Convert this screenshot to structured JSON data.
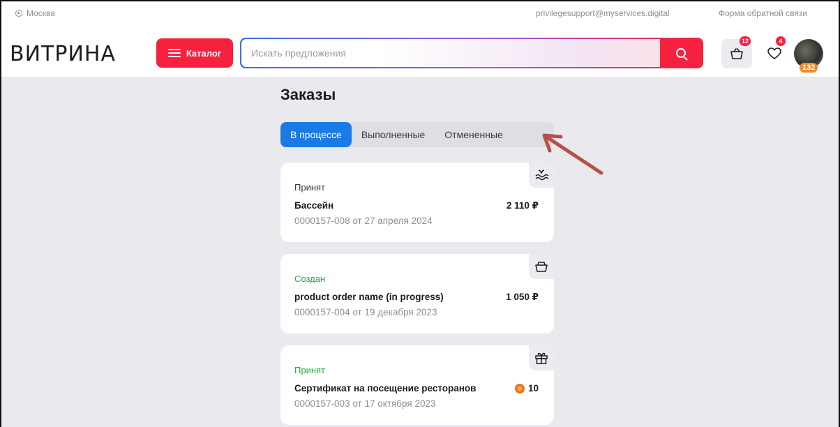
{
  "topbar": {
    "city": "Москва",
    "email": "privilegesupport@myservices.digital",
    "feedback": "Форма обратной связи"
  },
  "header": {
    "logo": "ВИТРИНА",
    "catalog_label": "Каталог",
    "search_placeholder": "Искать предложения",
    "cart_count": "12",
    "favorites_count": "4",
    "points": "132"
  },
  "orders": {
    "title": "Заказы",
    "tabs": [
      {
        "label": "В процессе",
        "active": true
      },
      {
        "label": "Выполненные",
        "active": false
      },
      {
        "label": "Отмененные",
        "active": false
      }
    ],
    "items": [
      {
        "status": "Принят",
        "status_color": "#3a3a3c",
        "name": "Бассейн",
        "price": "2 110 ₽",
        "meta": "0000157-008 от 27 апреля 2024",
        "icon": "pool-icon"
      },
      {
        "status": "Создан",
        "status_color": "#2aa84a",
        "name": "product order name (in progress)",
        "price": "1 050 ₽",
        "meta": "0000157-004 от 19 декабря 2023",
        "icon": "basket-icon"
      },
      {
        "status": "Принят",
        "status_color": "#2aa84a",
        "name": "Сертификат на посещение ресторанов",
        "price": "10",
        "meta": "0000157-003 от 17 октября 2023",
        "icon": "gift-icon"
      }
    ]
  },
  "colors": {
    "accent_red": "#f5213f",
    "tab_active": "#1a7be6",
    "annotation_arrow": "#b5504a"
  }
}
